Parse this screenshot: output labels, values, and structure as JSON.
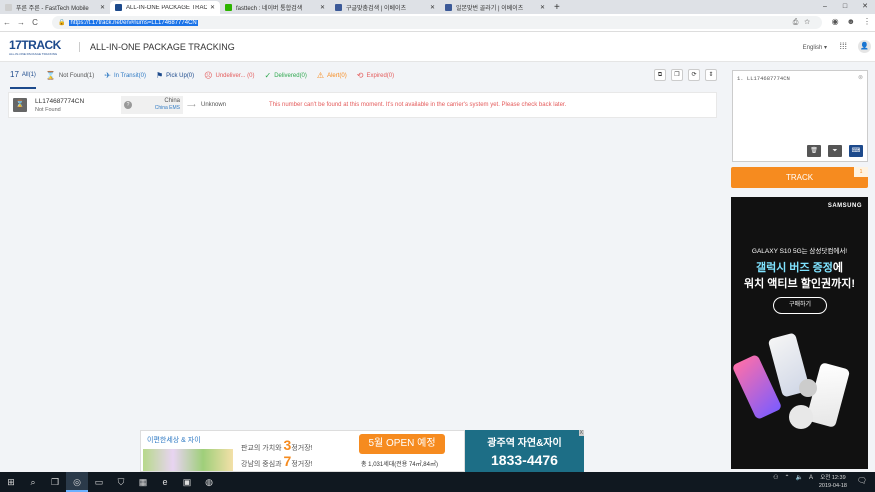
{
  "browser": {
    "tabs": [
      {
        "title": "푸른 주른 - FastTech Mobile",
        "color": "#cfcfcf",
        "active": false
      },
      {
        "title": "ALL-IN-ONE PACKAGE TRACKI",
        "color": "#1d4a8c",
        "active": true
      },
      {
        "title": "fasttech : 네이버 통합검색",
        "color": "#2db400",
        "active": false
      },
      {
        "title": "구글맞춤검색 | 이베이츠",
        "color": "#3b5998",
        "active": false
      },
      {
        "title": "일본맞번 골라기 | 이베이츠",
        "color": "#3b5998",
        "active": false
      }
    ],
    "url": "https://t.17track.net/en#nums=LL174687774CN",
    "back": "←",
    "forward": "→",
    "reload": "C",
    "new_tab": "+",
    "win_min": "–",
    "win_max": "□",
    "win_close": "✕"
  },
  "header": {
    "logo_main": "17TRACK",
    "logo_sub": "ALL-IN-ONE PACKAGE TRACKING",
    "title": "ALL-IN-ONE PACKAGE TRACKING",
    "language": "English ▾"
  },
  "filters": [
    {
      "icon": "17",
      "label": "All(1)",
      "color": "#1d4a8c"
    },
    {
      "icon": "⌛",
      "label": "Not Found(1)",
      "color": "#555555"
    },
    {
      "icon": "✈",
      "label": "In Transit(0)",
      "color": "#2f7ac4"
    },
    {
      "icon": "⚑",
      "label": "Pick Up(0)",
      "color": "#1d4a8c"
    },
    {
      "icon": "☹",
      "label": "Undeliver... (0)",
      "color": "#e45b5b"
    },
    {
      "icon": "✓",
      "label": "Delivered(0)",
      "color": "#2fa84f"
    },
    {
      "icon": "⚠",
      "label": "Alert(0)",
      "color": "#f68b1f"
    },
    {
      "icon": "⟲",
      "label": "Expired(0)",
      "color": "#e45b5b"
    }
  ],
  "result": {
    "number": "LL174687774CN",
    "status": "Not Found",
    "origin_country": "China",
    "origin_carrier": "China EMS",
    "destination": "Unknown",
    "message": "This number can't be found at this moment. It's not available in the carrier's system yet. Please check back later."
  },
  "sidebar": {
    "input_value": "1. LL174687774CN",
    "track_label": "TRACK",
    "track_count": "1"
  },
  "ad_side": {
    "brand": "SAMSUNG",
    "line1": "GALAXY S10 5G는 삼성닷컴에서!",
    "line2a": "갤럭시 버즈 증정",
    "line2b": "에",
    "line3a": "워치 액티브 할인권",
    "line3b": "까지!",
    "buy": "구매하기"
  },
  "ad_bottom": {
    "logo": "이편한세상 & 자이",
    "l1a": "판교의 가치와 ",
    "l1b": "3",
    "l1c": "정거장!",
    "l2a": "강남의 중심과 ",
    "l2b": "7",
    "l2c": "정거장!",
    "open": "5월 OPEN 예정",
    "units": "총 1,031세대(전용 74㎡,84㎡)",
    "r1": "광주역 자연&자이",
    "r2": "1833-4476",
    "close": "X"
  },
  "taskbar": {
    "time": "오전 12:39",
    "date": "2019-04-18",
    "lang": "A"
  }
}
